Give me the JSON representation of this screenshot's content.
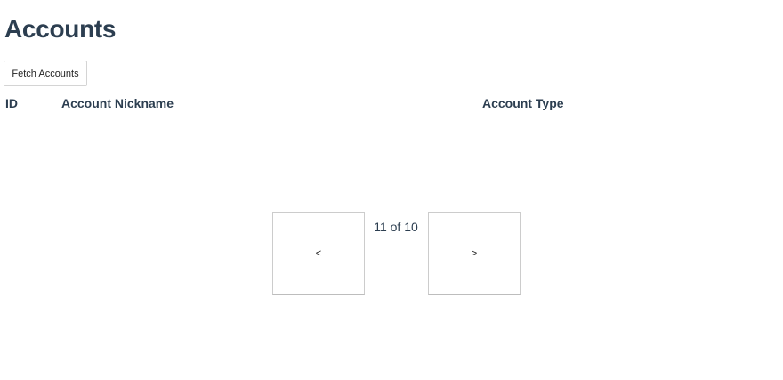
{
  "page": {
    "title": "Accounts"
  },
  "toolbar": {
    "fetch_label": "Fetch Accounts"
  },
  "table": {
    "columns": [
      "ID",
      "Account Nickname",
      "Account Type"
    ],
    "rows": []
  },
  "pagination": {
    "prev_label": "<",
    "next_label": ">",
    "indicator": "11 of 10"
  },
  "colors": {
    "heading_text": "#2c3e50",
    "button_border": "#cccccc",
    "background": "#ffffff"
  }
}
